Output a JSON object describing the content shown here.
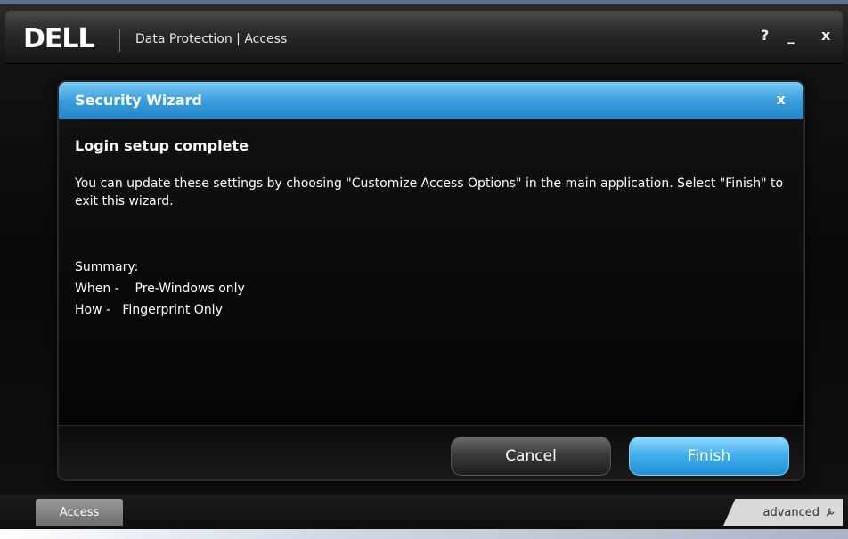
{
  "window": {
    "logo": "DELL",
    "title": "Data Protection | Access",
    "help_glyph": "?",
    "minimize_glyph": "_",
    "close_glyph": "x"
  },
  "dialog": {
    "title": "Security Wizard",
    "close_glyph": "x",
    "heading": "Login setup complete",
    "message": "You can update these settings by choosing \"Customize Access Options\" in the main application. Select \"Finish\" to exit this wizard.",
    "summary_label": "Summary:",
    "when_line": "When -    Pre-Windows only",
    "how_line": "How -   Fingerprint Only",
    "buttons": {
      "cancel": "Cancel",
      "finish": "Finish"
    }
  },
  "bottom": {
    "access_tab": "Access",
    "advanced_tab": "advanced"
  },
  "colors": {
    "header_blue": "#3a9ede",
    "finish_blue": "#45b1ec"
  }
}
